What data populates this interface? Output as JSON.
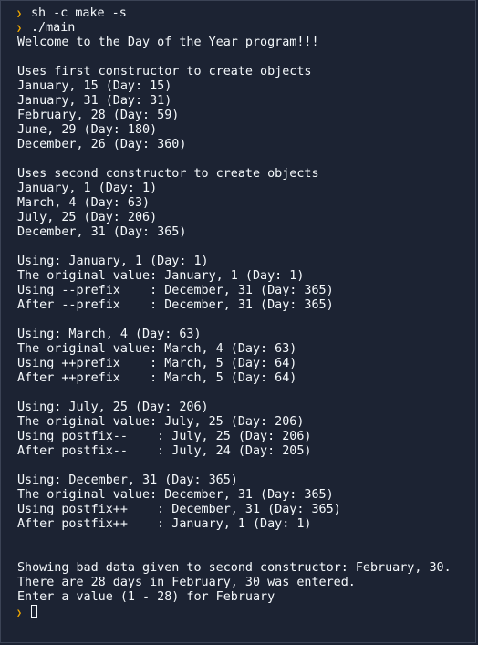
{
  "terminal": {
    "prompt_icon": "chevron-right-icon",
    "prompt_color": "#f0a800",
    "background": "#1c2333",
    "text_color": "#f5f9fc",
    "commands": [
      "sh -c make -s",
      "./main"
    ],
    "output_lines": [
      "Welcome to the Day of the Year program!!!",
      "",
      "Uses first constructor to create objects",
      "January, 15 (Day: 15)",
      "January, 31 (Day: 31)",
      "February, 28 (Day: 59)",
      "June, 29 (Day: 180)",
      "December, 26 (Day: 360)",
      "",
      "Uses second constructor to create objects",
      "January, 1 (Day: 1)",
      "March, 4 (Day: 63)",
      "July, 25 (Day: 206)",
      "December, 31 (Day: 365)",
      "",
      "Using: January, 1 (Day: 1)",
      "The original value: January, 1 (Day: 1)",
      "Using --prefix    : December, 31 (Day: 365)",
      "After --prefix    : December, 31 (Day: 365)",
      "",
      "Using: March, 4 (Day: 63)",
      "The original value: March, 4 (Day: 63)",
      "Using ++prefix    : March, 5 (Day: 64)",
      "After ++prefix    : March, 5 (Day: 64)",
      "",
      "Using: July, 25 (Day: 206)",
      "The original value: July, 25 (Day: 206)",
      "Using postfix--    : July, 25 (Day: 206)",
      "After postfix--    : July, 24 (Day: 205)",
      "",
      "Using: December, 31 (Day: 365)",
      "The original value: December, 31 (Day: 365)",
      "Using postfix++    : December, 31 (Day: 365)",
      "After postfix++    : January, 1 (Day: 1)",
      "",
      "",
      "Showing bad data given to second constructor: February, 30.",
      "There are 28 days in February, 30 was entered.",
      "Enter a value (1 - 28) for February"
    ],
    "input_value": ""
  }
}
